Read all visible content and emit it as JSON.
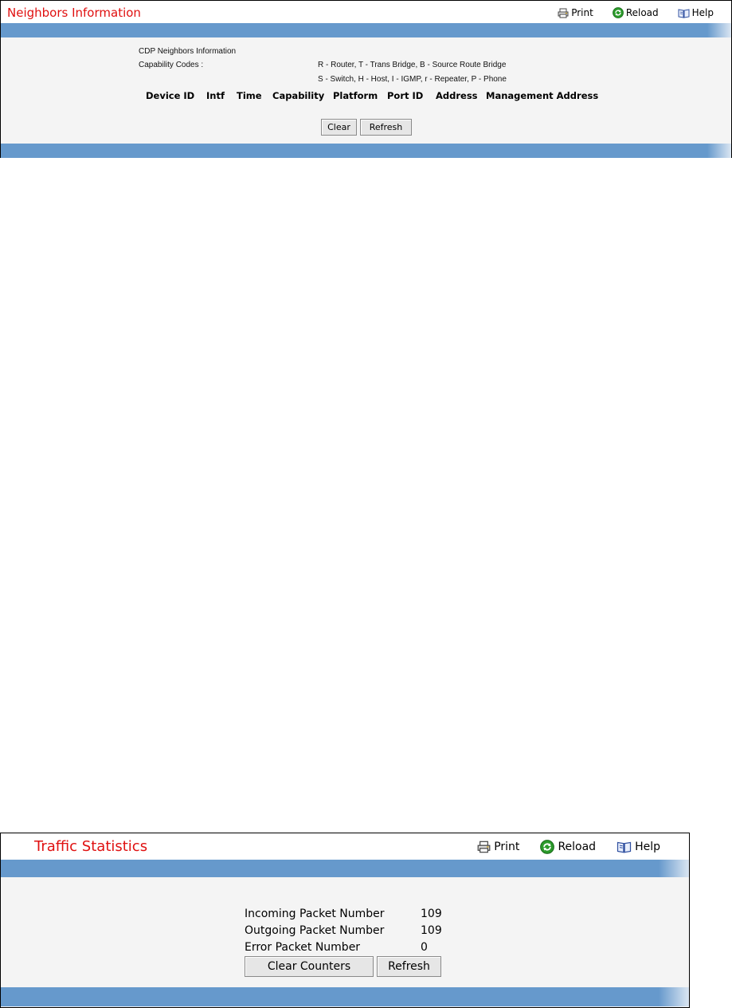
{
  "neighbors": {
    "title": "Neighbors Information",
    "toolbar": {
      "print": "Print",
      "reload": "Reload",
      "help": "Help"
    },
    "section_label": "CDP Neighbors Information",
    "capability_label": "Capability Codes :",
    "capability_codes_line1": "R - Router, T - Trans Bridge, B - Source Route Bridge",
    "capability_codes_line2": "S - Switch, H - Host, I - IGMP, r - Repeater, P - Phone",
    "columns": [
      "Device ID",
      "Intf",
      "Time",
      "Capability",
      "Platform",
      "Port ID",
      "Address",
      "Management Address"
    ],
    "buttons": {
      "clear": "Clear",
      "refresh": "Refresh"
    }
  },
  "traffic": {
    "title": "Traffic Statistics",
    "toolbar": {
      "print": "Print",
      "reload": "Reload",
      "help": "Help"
    },
    "rows": [
      {
        "label": "Incoming Packet Number",
        "value": "109"
      },
      {
        "label": "Outgoing Packet Number",
        "value": "109"
      },
      {
        "label": "Error Packet Number",
        "value": "0"
      }
    ],
    "buttons": {
      "clear_counters": "Clear Counters",
      "refresh": "Refresh"
    }
  },
  "colors": {
    "title": "#e01010",
    "bar": "#6699cc",
    "panel_bg": "#f4f4f4",
    "reload_icon": "#2a9a2a"
  },
  "icons": [
    "printer-icon",
    "reload-icon",
    "help-book-icon"
  ]
}
